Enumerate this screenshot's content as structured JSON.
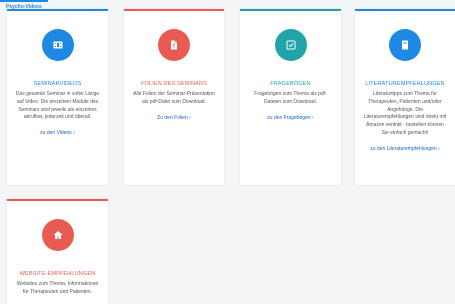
{
  "header": {
    "label": "Psycho-Videos",
    "accent": "#1e88e5"
  },
  "cards": [
    {
      "title": "SEMINARVIDEOS",
      "description": "Das gesamte Seminar in voller Länge auf Video. Die einzelnen Module des Seminars sind jeweils als einzelnes abrufbar, jederzeit und überall.",
      "link": "zu den Videos ›",
      "color": "#1e88e5",
      "icon": "film-icon"
    },
    {
      "title": "FOLIEN DES SEMINARS",
      "description": "Alle Folien der Seminar-Präsentation als pdf-Datei zum Download.",
      "link": "Zu den Folien ›",
      "color": "#e95b52",
      "icon": "document-icon"
    },
    {
      "title": "FRAGEBÖGEN",
      "description": "Fragebögen zum Thema als pdf-Dateien zum Download.",
      "link": "zu den Fragebögen ›",
      "color": "#1fa5a9",
      "icon": "checkbox-icon"
    },
    {
      "title": "LITERATUREMPFEHLUNGEN",
      "description": "Literaturtipps zum Thema für Therapeuten, Patienten und/oder Angehörige. Die Literaturempfehlungen sind direkt mit Amazon verlinkt - bestellen können Sie einfach gemacht!",
      "link": "zu den Literaturempfehlungen ›",
      "color": "#1e88e5",
      "icon": "book-icon"
    },
    {
      "title": "WEBSITE-EMPFEHLUNGEN",
      "description": "Websites zum Thema, Informationen für Therapeuten und Patienten.",
      "link": "",
      "color": "#e95b52",
      "icon": "home-icon"
    }
  ]
}
